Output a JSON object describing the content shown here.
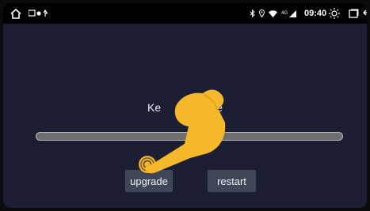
{
  "status_bar": {
    "home_icon": "home-icon",
    "notification_icons": [
      "image-icon",
      "dot-icon",
      "usb-icon"
    ],
    "system_icons": [
      "bluetooth-icon",
      "location-icon",
      "wifi-icon",
      "4g-signal-icon"
    ],
    "network_label": "4G",
    "time": "09:40",
    "brightness_icon": "brightness-icon",
    "recent_apps_icon": "window-icon",
    "back_icon": "back-icon"
  },
  "main": {
    "title": "Ke                  e"
  },
  "progress": {
    "value": 0
  },
  "buttons": {
    "upgrade_label": "upgrade",
    "restart_label": "restart"
  },
  "overlay": {
    "tutorial_hand_color": "#f5b82a",
    "tap_indicator_color": "#f5b82a"
  }
}
